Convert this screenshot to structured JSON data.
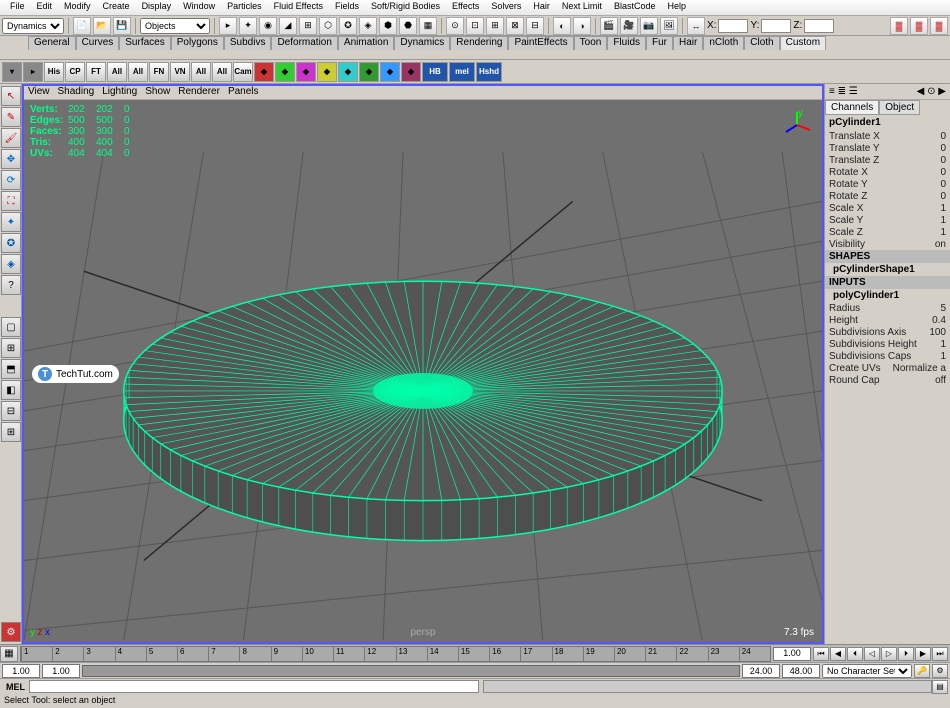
{
  "menubar": [
    "File",
    "Edit",
    "Modify",
    "Create",
    "Display",
    "Window",
    "Particles",
    "Fluid Effects",
    "Fields",
    "Soft/Rigid Bodies",
    "Effects",
    "Solvers",
    "Hair",
    "Next Limit",
    "BlastCode",
    "Help"
  ],
  "toolbar": {
    "mode_dropdown": "Dynamics",
    "selector_dropdown": "Objects",
    "x_label": "X:",
    "y_label": "Y:",
    "z_label": "Z:",
    "x_val": "",
    "y_val": "",
    "z_val": ""
  },
  "shelf_tabs": [
    "General",
    "Curves",
    "Surfaces",
    "Polygons",
    "Subdivs",
    "Deformation",
    "Animation",
    "Dynamics",
    "Rendering",
    "PaintEffects",
    "Toon",
    "Fluids",
    "Fur",
    "Hair",
    "nCloth",
    "Cloth",
    "Custom"
  ],
  "shelf_active": "Custom",
  "shelf2_buttons": [
    "His",
    "CP",
    "FT",
    "All",
    "All",
    "FN",
    "VN",
    "All",
    "All",
    "Cam"
  ],
  "shelf2_extra": [
    "HB",
    "mel",
    "Hshd"
  ],
  "viewport_menus": [
    "View",
    "Shading",
    "Lighting",
    "Show",
    "Renderer",
    "Panels"
  ],
  "hud": {
    "rows": [
      {
        "label": "Verts:",
        "a": "202",
        "b": "202",
        "c": "0"
      },
      {
        "label": "Edges:",
        "a": "500",
        "b": "500",
        "c": "0"
      },
      {
        "label": "Faces:",
        "a": "300",
        "b": "300",
        "c": "0"
      },
      {
        "label": "Tris:",
        "a": "400",
        "b": "400",
        "c": "0"
      },
      {
        "label": "UVs:",
        "a": "404",
        "b": "404",
        "c": "0"
      }
    ]
  },
  "viewport": {
    "label": "persp",
    "fps": "7.3 fps"
  },
  "watermark": "TechTut.com",
  "channel": {
    "tabs": [
      "Channels",
      "Object"
    ],
    "object_name": "pCylinder1",
    "attrs": [
      {
        "n": "Translate X",
        "v": "0"
      },
      {
        "n": "Translate Y",
        "v": "0"
      },
      {
        "n": "Translate Z",
        "v": "0"
      },
      {
        "n": "Rotate X",
        "v": "0"
      },
      {
        "n": "Rotate Y",
        "v": "0"
      },
      {
        "n": "Rotate Z",
        "v": "0"
      },
      {
        "n": "Scale X",
        "v": "1"
      },
      {
        "n": "Scale Y",
        "v": "1"
      },
      {
        "n": "Scale Z",
        "v": "1"
      },
      {
        "n": "Visibility",
        "v": "on"
      }
    ],
    "shapes_label": "SHAPES",
    "shape_name": "pCylinderShape1",
    "inputs_label": "INPUTS",
    "input_name": "polyCylinder1",
    "input_attrs": [
      {
        "n": "Radius",
        "v": "5"
      },
      {
        "n": "Height",
        "v": "0.4"
      },
      {
        "n": "Subdivisions Axis",
        "v": "100"
      },
      {
        "n": "Subdivisions Height",
        "v": "1"
      },
      {
        "n": "Subdivisions Caps",
        "v": "1"
      },
      {
        "n": "Create UVs",
        "v": "Normalize a"
      },
      {
        "n": "Round Cap",
        "v": "off"
      }
    ]
  },
  "timeline": {
    "ticks": [
      "1",
      "2",
      "3",
      "4",
      "5",
      "6",
      "7",
      "8",
      "9",
      "10",
      "11",
      "12",
      "13",
      "14",
      "15",
      "16",
      "17",
      "18",
      "19",
      "20",
      "21",
      "22",
      "23",
      "24"
    ],
    "end_box": "1.00"
  },
  "range": {
    "start": "1.00",
    "range_start": "1.00",
    "range_end": "24.00",
    "end": "48.00",
    "char_set": "No Character Set"
  },
  "cmd": {
    "label": "MEL"
  },
  "status": "Select Tool: select an object"
}
